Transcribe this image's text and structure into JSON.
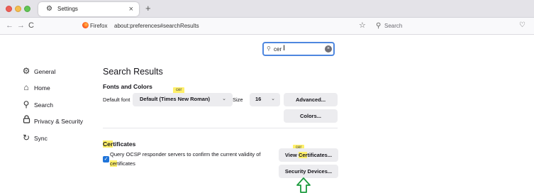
{
  "window": {
    "tab_title": "Settings",
    "new_tab": "+",
    "tab_close": "×"
  },
  "navbar": {
    "back": "←",
    "forward": "→",
    "reload": "C",
    "url_identity": "Firefox",
    "url": "about:preferences#searchResults",
    "search_placeholder": "Search"
  },
  "find": {
    "value": "cer",
    "clear": "×"
  },
  "sidebar": {
    "items": [
      {
        "label": "General",
        "icon": "gear-icon",
        "glyph": "⚙"
      },
      {
        "label": "Home",
        "icon": "home-icon",
        "glyph": "⌂"
      },
      {
        "label": "Search",
        "icon": "search-icon",
        "glyph": "⚲"
      },
      {
        "label": "Privacy & Security",
        "icon": "lock-icon",
        "glyph": "🔒"
      },
      {
        "label": "Sync",
        "icon": "sync-icon",
        "glyph": "↻"
      }
    ]
  },
  "main": {
    "title": "Search Results",
    "fonts_heading": "Fonts and Colors",
    "fonts_bubble": "cer",
    "default_font_label": "Default font",
    "default_font_value": "Default (Times New Roman)",
    "size_label": "Size",
    "size_value": "16",
    "advanced_button": "Advanced...",
    "colors_button": "Colors...",
    "certs_heading_hl": "Cer",
    "certs_heading_rest": "tificates",
    "ocsp_text_line1": "Query OCSP responder servers to confirm the current validity of",
    "ocsp_line2_hl": "cer",
    "ocsp_line2_rest": "tificates",
    "view_bubble": "cer",
    "view_button_pre": "View ",
    "view_button_hl": "Cer",
    "view_button_post": "tificates...",
    "security_devices_button": "Security Devices..."
  },
  "colors": {
    "highlight": "#fff069",
    "accent": "#1f74d9",
    "arrow": "#1a9a3c"
  }
}
